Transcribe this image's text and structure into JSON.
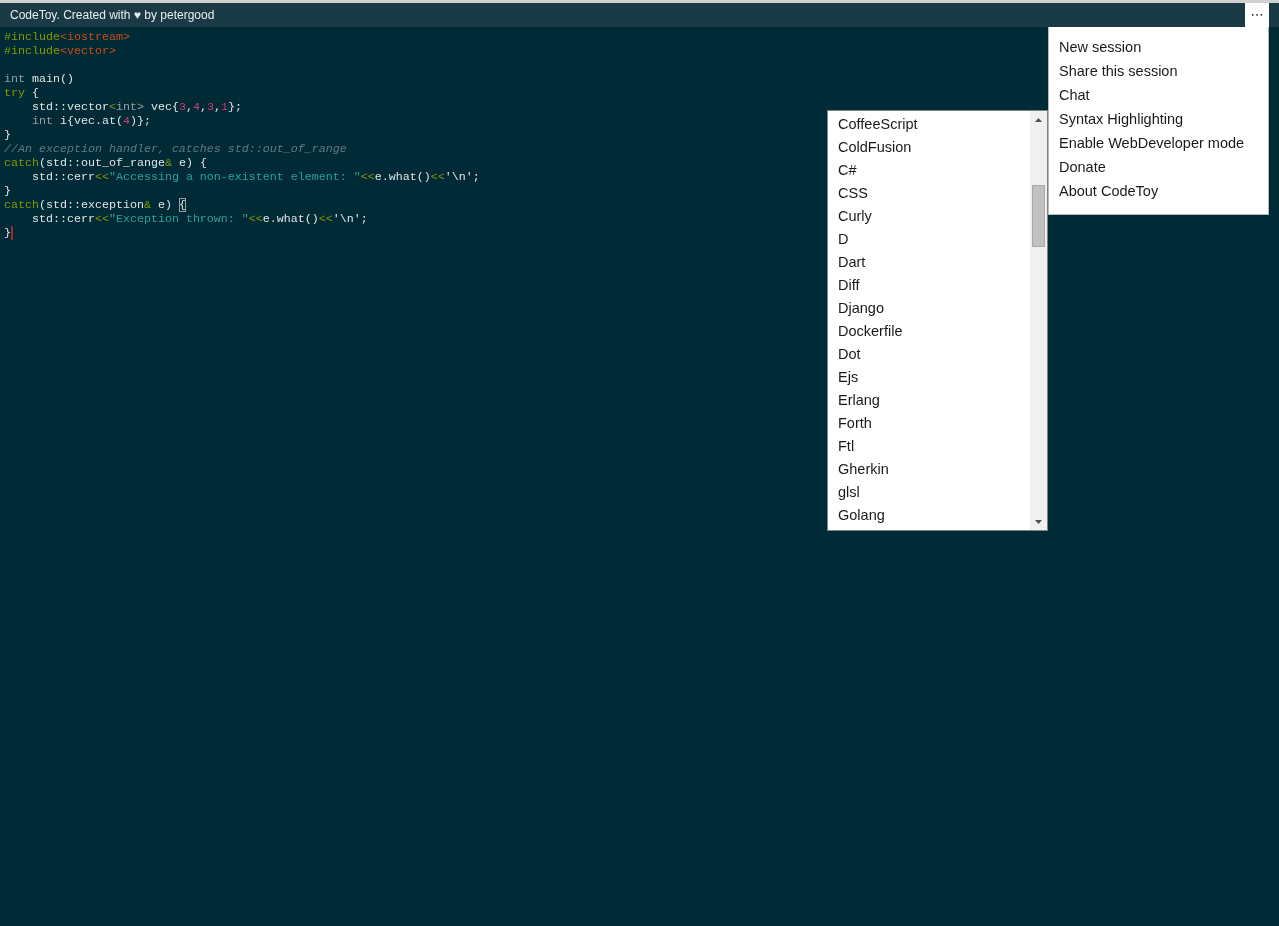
{
  "top_bar": {
    "title": "CodeToy. Created with ♥ by petergood",
    "menu_button": {
      "label": "⋯"
    }
  },
  "editor": {
    "lines": [
      {
        "kind": "code",
        "tokens": [
          {
            "kind": "directive",
            "text": "#include"
          },
          {
            "kind": "header",
            "text": "<iostream>"
          }
        ]
      },
      {
        "kind": "code",
        "tokens": [
          {
            "kind": "directive",
            "text": "#include"
          },
          {
            "kind": "header",
            "text": "<vector>"
          }
        ]
      },
      {
        "kind": "blank"
      },
      {
        "kind": "code",
        "tokens": [
          {
            "kind": "type",
            "text": "int"
          },
          {
            "kind": "plain",
            "text": " main()"
          }
        ]
      },
      {
        "kind": "code",
        "tokens": [
          {
            "kind": "keyword",
            "text": "try"
          },
          {
            "kind": "plain",
            "text": " {"
          }
        ]
      },
      {
        "kind": "code",
        "tokens": [
          {
            "kind": "plain",
            "text": "    std::vector"
          },
          {
            "kind": "operator",
            "text": "<"
          },
          {
            "kind": "type",
            "text": "int>"
          },
          {
            "kind": "plain",
            "text": " vec{"
          },
          {
            "kind": "number",
            "text": "3"
          },
          {
            "kind": "plain",
            "text": ","
          },
          {
            "kind": "number",
            "text": "4"
          },
          {
            "kind": "plain",
            "text": ","
          },
          {
            "kind": "number",
            "text": "3"
          },
          {
            "kind": "plain",
            "text": ","
          },
          {
            "kind": "number",
            "text": "1"
          },
          {
            "kind": "plain",
            "text": "};"
          }
        ]
      },
      {
        "kind": "code",
        "tokens": [
          {
            "kind": "type",
            "text": "    int"
          },
          {
            "kind": "plain",
            "text": " i{vec.at("
          },
          {
            "kind": "number",
            "text": "4"
          },
          {
            "kind": "plain",
            "text": ")};"
          }
        ]
      },
      {
        "kind": "code",
        "tokens": [
          {
            "kind": "plain",
            "text": "}"
          }
        ]
      },
      {
        "kind": "code",
        "tokens": [
          {
            "kind": "comment",
            "text": "//An exception handler, catches std::out_of_range"
          }
        ]
      },
      {
        "kind": "code",
        "tokens": [
          {
            "kind": "keyword",
            "text": "catch"
          },
          {
            "kind": "plain",
            "text": "(std::out_of_range"
          },
          {
            "kind": "operator",
            "text": "&"
          },
          {
            "kind": "plain",
            "text": " e) {"
          }
        ]
      },
      {
        "kind": "code",
        "tokens": [
          {
            "kind": "plain",
            "text": "    std::cerr"
          },
          {
            "kind": "operator",
            "text": "<<"
          },
          {
            "kind": "string",
            "text": "\"Accessing a non-existent element: \""
          },
          {
            "kind": "operator",
            "text": "<<"
          },
          {
            "kind": "plain",
            "text": "e.what()"
          },
          {
            "kind": "operator",
            "text": "<<"
          },
          {
            "kind": "plain",
            "text": "'\\n';"
          }
        ]
      },
      {
        "kind": "code",
        "tokens": [
          {
            "kind": "plain",
            "text": "}"
          }
        ]
      },
      {
        "kind": "code",
        "tokens": [
          {
            "kind": "keyword",
            "text": "catch"
          },
          {
            "kind": "plain",
            "text": "(std::exception"
          },
          {
            "kind": "operator",
            "text": "&"
          },
          {
            "kind": "plain",
            "text": " e) "
          },
          {
            "kind": "match",
            "text": "{"
          }
        ]
      },
      {
        "kind": "code",
        "tokens": [
          {
            "kind": "plain",
            "text": "    std::cerr"
          },
          {
            "kind": "operator",
            "text": "<<"
          },
          {
            "kind": "string",
            "text": "\"Exception thrown: \""
          },
          {
            "kind": "operator",
            "text": "<<"
          },
          {
            "kind": "plain",
            "text": "e.what()"
          },
          {
            "kind": "operator",
            "text": "<<"
          },
          {
            "kind": "plain",
            "text": "'\\n';"
          }
        ]
      },
      {
        "kind": "code",
        "tokens": [
          {
            "kind": "plain",
            "text": "}"
          },
          {
            "kind": "cursor"
          }
        ]
      }
    ]
  },
  "language_list": {
    "items": [
      "CoffeeScript",
      "ColdFusion",
      "C#",
      "CSS",
      "Curly",
      "D",
      "Dart",
      "Diff",
      "Django",
      "Dockerfile",
      "Dot",
      "Ejs",
      "Erlang",
      "Forth",
      "Ftl",
      "Gherkin",
      "glsl",
      "Golang"
    ]
  },
  "menu": {
    "open": true,
    "items": [
      "New session",
      "Share this session",
      "Chat",
      "Syntax Highlighting",
      "Enable WebDeveloper mode",
      "Donate",
      "About CodeToy"
    ]
  }
}
